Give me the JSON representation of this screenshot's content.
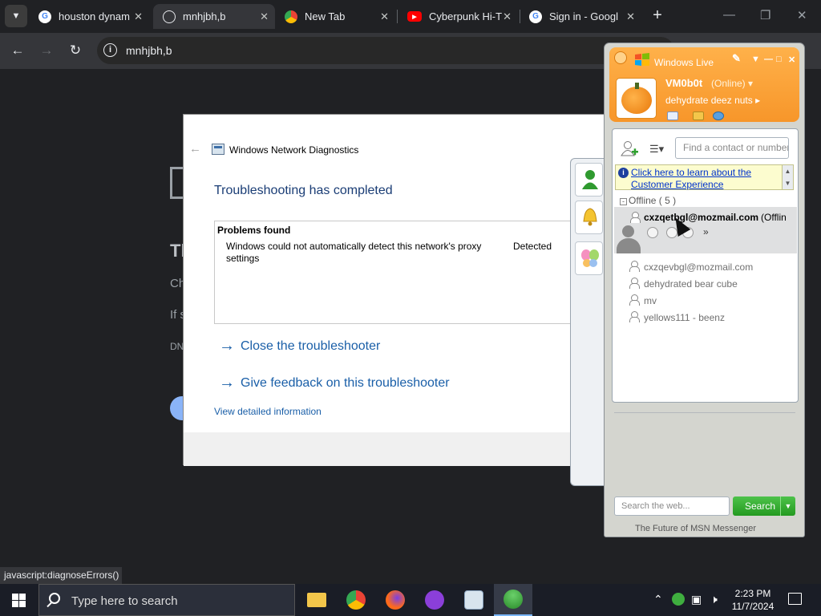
{
  "browser": {
    "tabs": [
      {
        "title": "houston dynam",
        "icon": "google-icon",
        "active": false
      },
      {
        "title": "mnhjbh,b",
        "icon": "globe-icon",
        "active": true
      },
      {
        "title": "New Tab",
        "icon": "chrome-icon",
        "active": false
      },
      {
        "title": "Cyberpunk Hi-T",
        "icon": "youtube-icon",
        "active": false
      },
      {
        "title": "Sign in - Googl",
        "icon": "google-icon",
        "active": false
      }
    ],
    "address": "mnhjbh,b",
    "status_url": "javascript:diagnoseErrors()",
    "bg_fragments": [
      "Th",
      "Ch",
      "If s",
      "DN"
    ]
  },
  "diagnostics": {
    "window_title": "Windows Network Diagnostics",
    "heading": "Troubleshooting has completed",
    "problems_header": "Problems found",
    "problem_text": "Windows could not automatically detect this network's proxy settings",
    "problem_status": "Detected",
    "link_close": "Close the troubleshooter",
    "link_feedback": "Give feedback on this troubleshooter",
    "link_details": "View detailed information"
  },
  "messenger": {
    "title": "Windows Live",
    "user": {
      "name": "VM0b0t",
      "status": "(Online)",
      "message": "dehydrate deez nuts"
    },
    "find_placeholder": "Find a contact or number",
    "info_text": "Click here to learn about the Customer Experience",
    "group": "Offline ( 5 )",
    "selected_contact": {
      "email": "cxzqetbgl@mozmail.com",
      "status": "(Offlin"
    },
    "contacts": [
      "cxzqevbgl@mozmail.com",
      "dehydrated bear cube",
      "mv",
      "yellows111 - beenz"
    ],
    "web_search_placeholder": "Search the web...",
    "search_button": "Search",
    "footer": "The Future of MSN Messenger"
  },
  "taskbar": {
    "search_placeholder": "Type here to search",
    "apps": [
      "file-explorer",
      "chrome",
      "firefox",
      "app-purple",
      "network-diagnostics",
      "messenger"
    ],
    "time": "2:23 PM",
    "date": "11/7/2024"
  },
  "colors": {
    "accent_blue": "#1a5fa8",
    "messenger_orange": "#f7962a",
    "search_green": "#249a20"
  }
}
